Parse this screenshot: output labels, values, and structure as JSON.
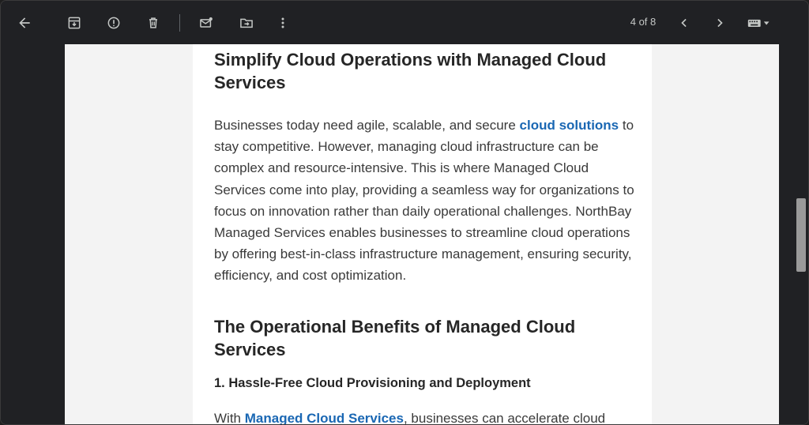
{
  "toolbar": {
    "back_icon": "arrow-left-icon",
    "archive_icon": "archive-icon",
    "report_icon": "report-spam-icon",
    "delete_icon": "trash-icon",
    "mark_unread_icon": "mark-unread-icon",
    "move_icon": "move-to-folder-icon",
    "more_icon": "more-vertical-icon",
    "page_count": "4 of 8",
    "prev_icon": "chevron-left-icon",
    "next_icon": "chevron-right-icon",
    "keyboard_icon": "keyboard-icon"
  },
  "article": {
    "heading1": "Simplify Cloud Operations with Managed Cloud Services",
    "para1_before_link": "Businesses today need agile, scalable, and secure ",
    "para1_link": "cloud solutions",
    "para1_after_link": " to stay competitive. However, managing cloud infrastructure can be complex and resource-intensive. This is where Managed Cloud Services come into play, providing a seamless way for organizations to focus on innovation rather than daily operational challenges. NorthBay Managed Services enables businesses to streamline cloud operations by offering best-in-class infrastructure management, ensuring security, efficiency, and cost optimization.",
    "heading2": "The Operational Benefits of Managed Cloud Services",
    "subheading1": "1. Hassle-Free Cloud Provisioning and Deployment",
    "para2_before_link": "With ",
    "para2_link": "Managed Cloud Services",
    "para2_after_link": ", businesses can accelerate cloud"
  },
  "colors": {
    "toolbar_bg": "#202124",
    "link": "#1a67b3",
    "page_bg": "#f3f3f3"
  }
}
